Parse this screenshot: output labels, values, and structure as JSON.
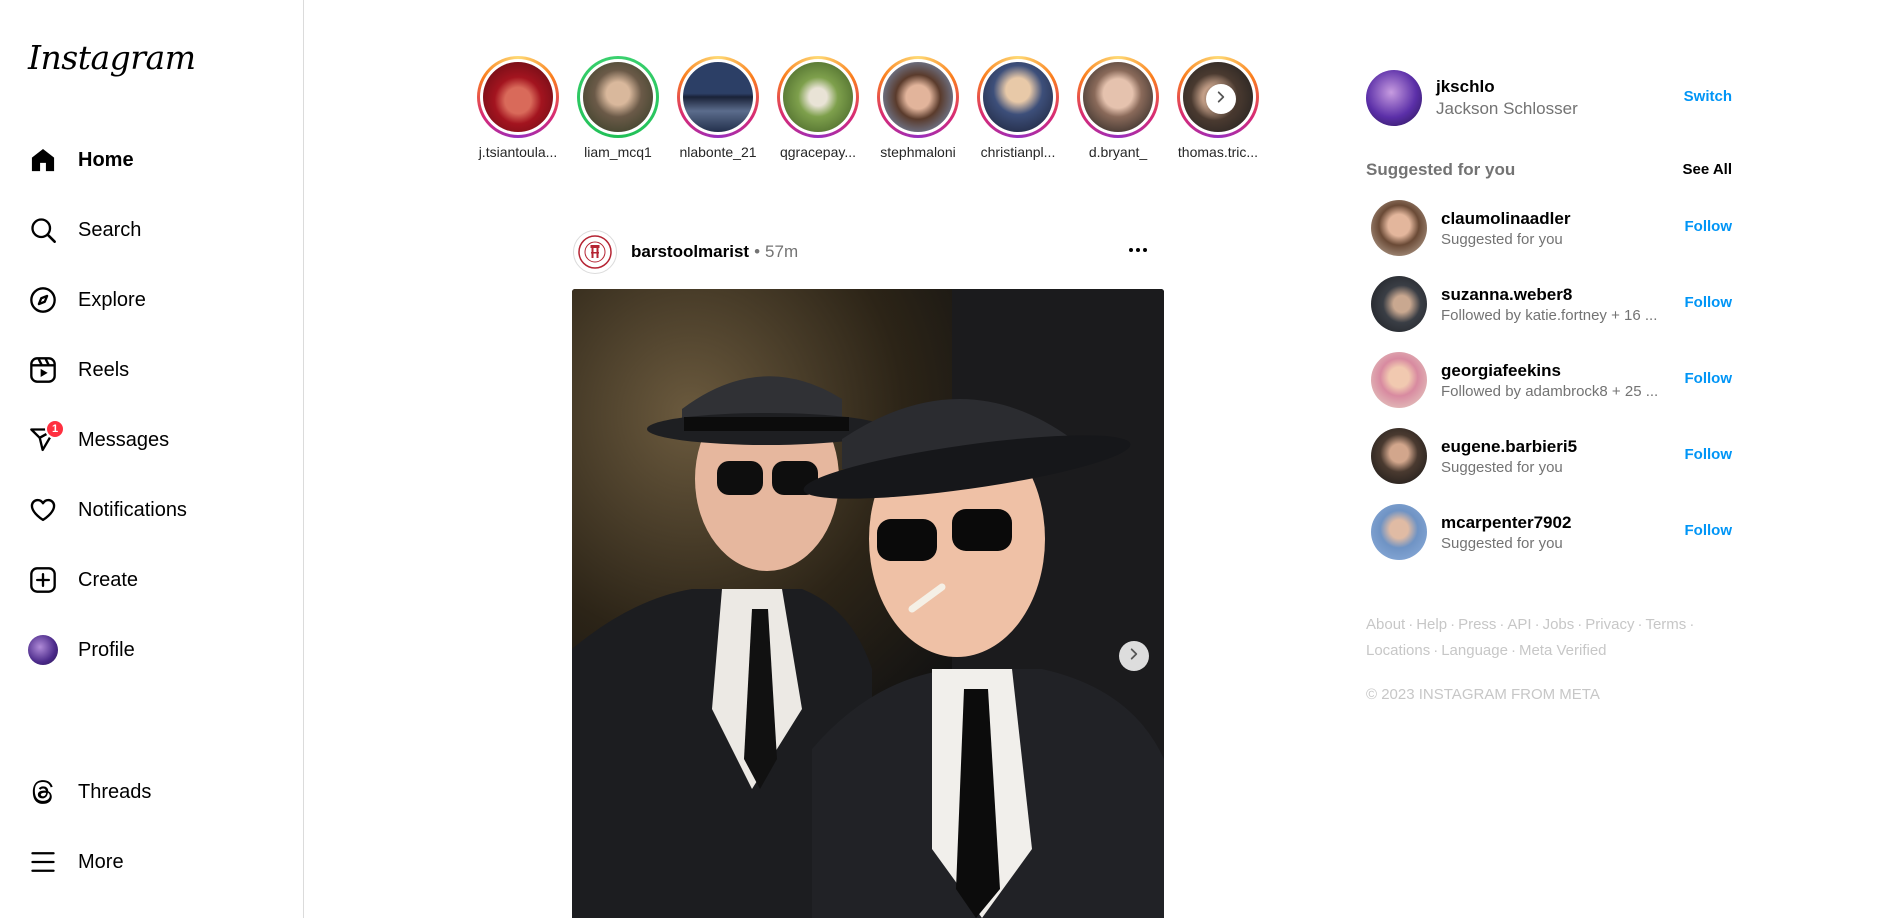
{
  "app": {
    "logo_text": "Instagram"
  },
  "sidebar": {
    "items": [
      {
        "label": "Home",
        "icon": "home-icon",
        "active": true
      },
      {
        "label": "Search",
        "icon": "search-icon"
      },
      {
        "label": "Explore",
        "icon": "compass-icon"
      },
      {
        "label": "Reels",
        "icon": "reels-icon"
      },
      {
        "label": "Messages",
        "icon": "messages-icon",
        "badge": "1"
      },
      {
        "label": "Notifications",
        "icon": "heart-icon"
      },
      {
        "label": "Create",
        "icon": "plus-square-icon"
      },
      {
        "label": "Profile",
        "icon": "avatar"
      }
    ],
    "bottom": [
      {
        "label": "Threads",
        "icon": "threads-icon"
      },
      {
        "label": "More",
        "icon": "menu-icon"
      }
    ]
  },
  "stories": [
    {
      "username": "j.tsiantoula..."
    },
    {
      "username": "liam_mcq1",
      "close_friend": true
    },
    {
      "username": "nlabonte_21"
    },
    {
      "username": "qgracepay..."
    },
    {
      "username": "stephmaloni"
    },
    {
      "username": "christianpl..."
    },
    {
      "username": "d.bryant_"
    },
    {
      "username": "thomas.tric..."
    }
  ],
  "post": {
    "username": "barstoolmarist",
    "separator": "•",
    "time": "57m"
  },
  "account": {
    "username": "jkschlo",
    "full_name": "Jackson Schlosser",
    "switch_label": "Switch"
  },
  "suggestions": {
    "title": "Suggested for you",
    "see_all_label": "See All",
    "follow_label": "Follow",
    "items": [
      {
        "username": "claumolinaadler",
        "subtitle": "Suggested for you"
      },
      {
        "username": "suzanna.weber8",
        "subtitle": "Followed by katie.fortney + 16 ..."
      },
      {
        "username": "georgiafeekins",
        "subtitle": "Followed by adambrock8 + 25 ..."
      },
      {
        "username": "eugene.barbieri5",
        "subtitle": "Suggested for you"
      },
      {
        "username": "mcarpenter7902",
        "subtitle": "Suggested for you"
      }
    ]
  },
  "footer": {
    "links": [
      "About",
      "Help",
      "Press",
      "API",
      "Jobs",
      "Privacy",
      "Terms",
      "Locations",
      "Language",
      "Meta Verified"
    ],
    "separator": "·",
    "copyright": "© 2023 INSTAGRAM FROM META"
  },
  "colors": {
    "link_blue": "#0095f6",
    "muted_text": "#737373",
    "badge_red": "#ff3040",
    "border": "#dbdbdb"
  }
}
